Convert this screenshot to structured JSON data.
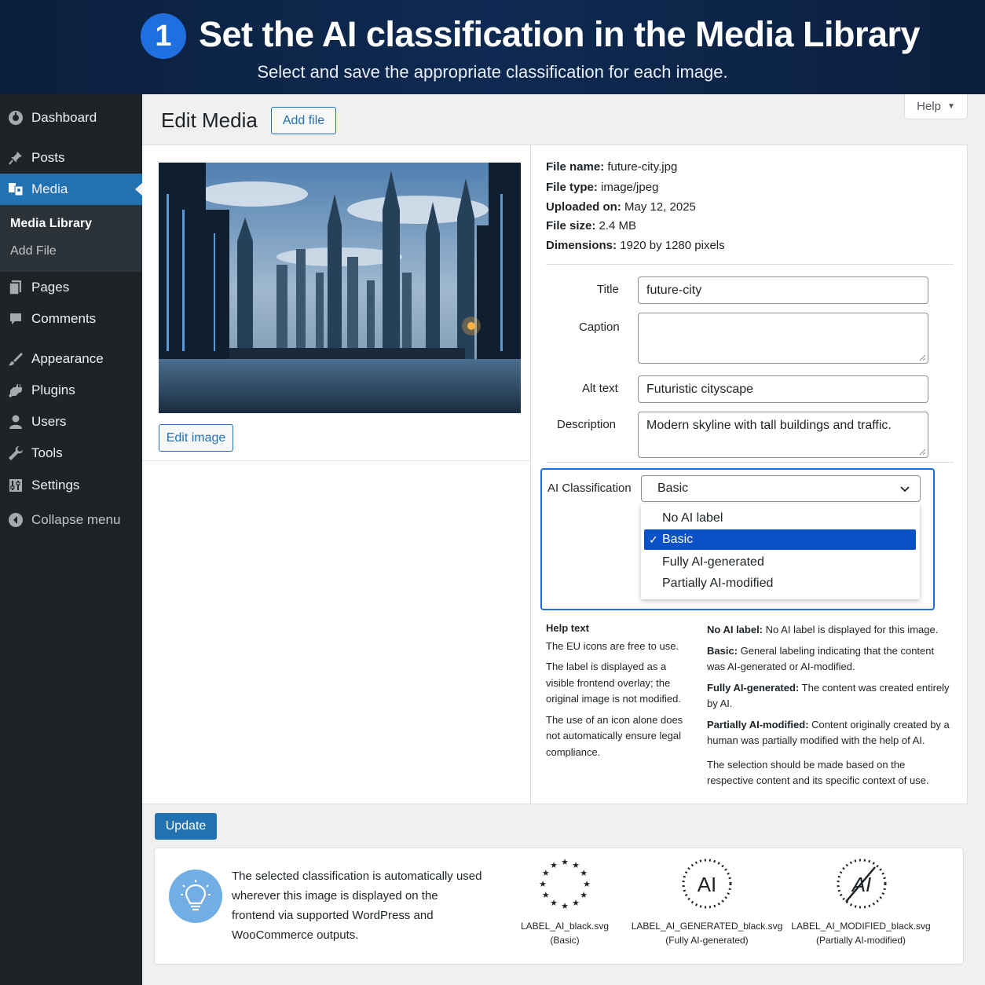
{
  "banner": {
    "step": "1",
    "title": "Set the AI classification in the Media Library",
    "subtitle": "Select and save the appropriate classification for each image."
  },
  "sidebar": {
    "items": [
      {
        "label": "Dashboard",
        "icon": "dashboard-icon"
      },
      {
        "label": "Posts",
        "icon": "pin-icon"
      },
      {
        "label": "Media",
        "icon": "media-icon",
        "active": true
      },
      {
        "label": "Pages",
        "icon": "page-icon"
      },
      {
        "label": "Comments",
        "icon": "comment-icon"
      },
      {
        "label": "Appearance",
        "icon": "brush-icon"
      },
      {
        "label": "Plugins",
        "icon": "plug-icon"
      },
      {
        "label": "Users",
        "icon": "user-icon"
      },
      {
        "label": "Tools",
        "icon": "wrench-icon"
      },
      {
        "label": "Settings",
        "icon": "settings-icon"
      }
    ],
    "submenu": [
      "Media Library",
      "Add File"
    ],
    "collapse": "Collapse menu"
  },
  "header": {
    "title": "Edit Media",
    "add_file": "Add file",
    "help": "Help"
  },
  "media": {
    "edit_image": "Edit image",
    "meta": [
      {
        "label": "File name:",
        "value": "future-city.jpg"
      },
      {
        "label": "File type:",
        "value": "image/jpeg"
      },
      {
        "label": "Uploaded on:",
        "value": "May 12, 2025"
      },
      {
        "label": "File size:",
        "value": "2.4 MB"
      },
      {
        "label": "Dimensions:",
        "value": "1920 by 1280 pixels"
      }
    ]
  },
  "form": {
    "title_label": "Title",
    "title_value": "future-city",
    "caption_label": "Caption",
    "caption_value": "",
    "alt_label": "Alt text",
    "alt_value": "Futuristic cityscape",
    "desc_label": "Description",
    "desc_value": "Modern skyline with tall buildings and traffic."
  },
  "ai": {
    "label": "AI Classification",
    "selected": "Basic",
    "options": [
      "No AI label",
      "Basic",
      "Fully AI-generated",
      "Partially AI-modified"
    ],
    "selected_index": 1
  },
  "help": {
    "heading": "Help text",
    "left": [
      "The EU icons are free to use.",
      "The label is displayed as a visible frontend overlay; the original image is not modified.",
      "The use of an icon alone does not automatically ensure legal compliance."
    ],
    "right": [
      {
        "term": "No AI label:",
        "text": "No AI label is displayed for this image."
      },
      {
        "term": "Basic:",
        "text": "General labeling indicating that the content was AI-generated or AI-modified."
      },
      {
        "term": "Fully AI-generated:",
        "text": "The content was created entirely by AI."
      },
      {
        "term": "Partially AI-modified:",
        "text": "Content originally created by a human was partially modified with the help of AI."
      }
    ],
    "note": "The selection should be made based on the respective content and its specific context of use."
  },
  "update": "Update",
  "info": {
    "text": "The selected classification is automatically used wherever this image is displayed on the frontend via supported WordPress and WooCommerce outputs.",
    "labels": [
      {
        "file": "LABEL_AI_black.svg",
        "caption": "(Basic)",
        "mark": ""
      },
      {
        "file": "LABEL_AI_GENERATED_black.svg",
        "caption": "(Fully AI-generated)",
        "mark": "AI"
      },
      {
        "file": "LABEL_AI_MODIFIED_black.svg",
        "caption": "(Partially AI-modified)",
        "mark": "AI"
      }
    ]
  },
  "colors": {
    "banner": "#0e2a52",
    "accent": "#2271b1",
    "sidebar": "#1d2327",
    "highlight": "#0a51c8"
  }
}
